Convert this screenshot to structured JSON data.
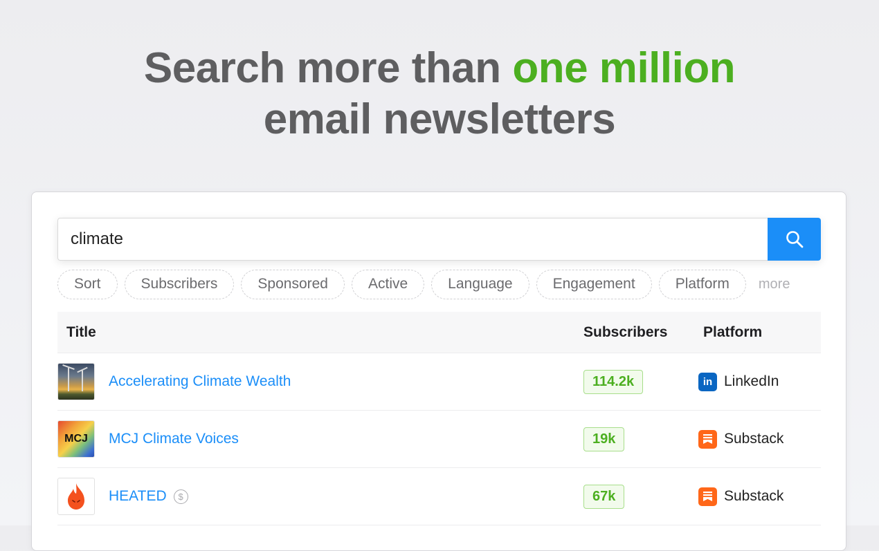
{
  "hero": {
    "line1_prefix": "Search more than",
    "line1_accent": "one million",
    "line2": "email newsletters"
  },
  "search": {
    "value": "climate",
    "button_icon": "search-icon"
  },
  "filters": [
    "Sort",
    "Subscribers",
    "Sponsored",
    "Active",
    "Language",
    "Engagement",
    "Platform"
  ],
  "filters_more": "more",
  "table": {
    "headers": {
      "title": "Title",
      "subscribers": "Subscribers",
      "platform": "Platform"
    },
    "rows": [
      {
        "title": "Accelerating Climate Wealth",
        "subscribers": "114.2k",
        "platform": "LinkedIn",
        "platform_icon": "linkedin-icon",
        "sponsored": false
      },
      {
        "title": "MCJ Climate Voices",
        "subscribers": "19k",
        "platform": "Substack",
        "platform_icon": "substack-icon",
        "sponsored": false,
        "thumb_text": "MCJ"
      },
      {
        "title": "HEATED",
        "subscribers": "67k",
        "platform": "Substack",
        "platform_icon": "substack-icon",
        "sponsored": true,
        "sponsored_symbol": "$"
      }
    ]
  },
  "colors": {
    "accent_green": "#4caf20",
    "link_blue": "#1b8ef8",
    "linkedin": "#0a66c2",
    "substack": "#ff6719"
  },
  "icons": {
    "linkedin_text": "in"
  }
}
